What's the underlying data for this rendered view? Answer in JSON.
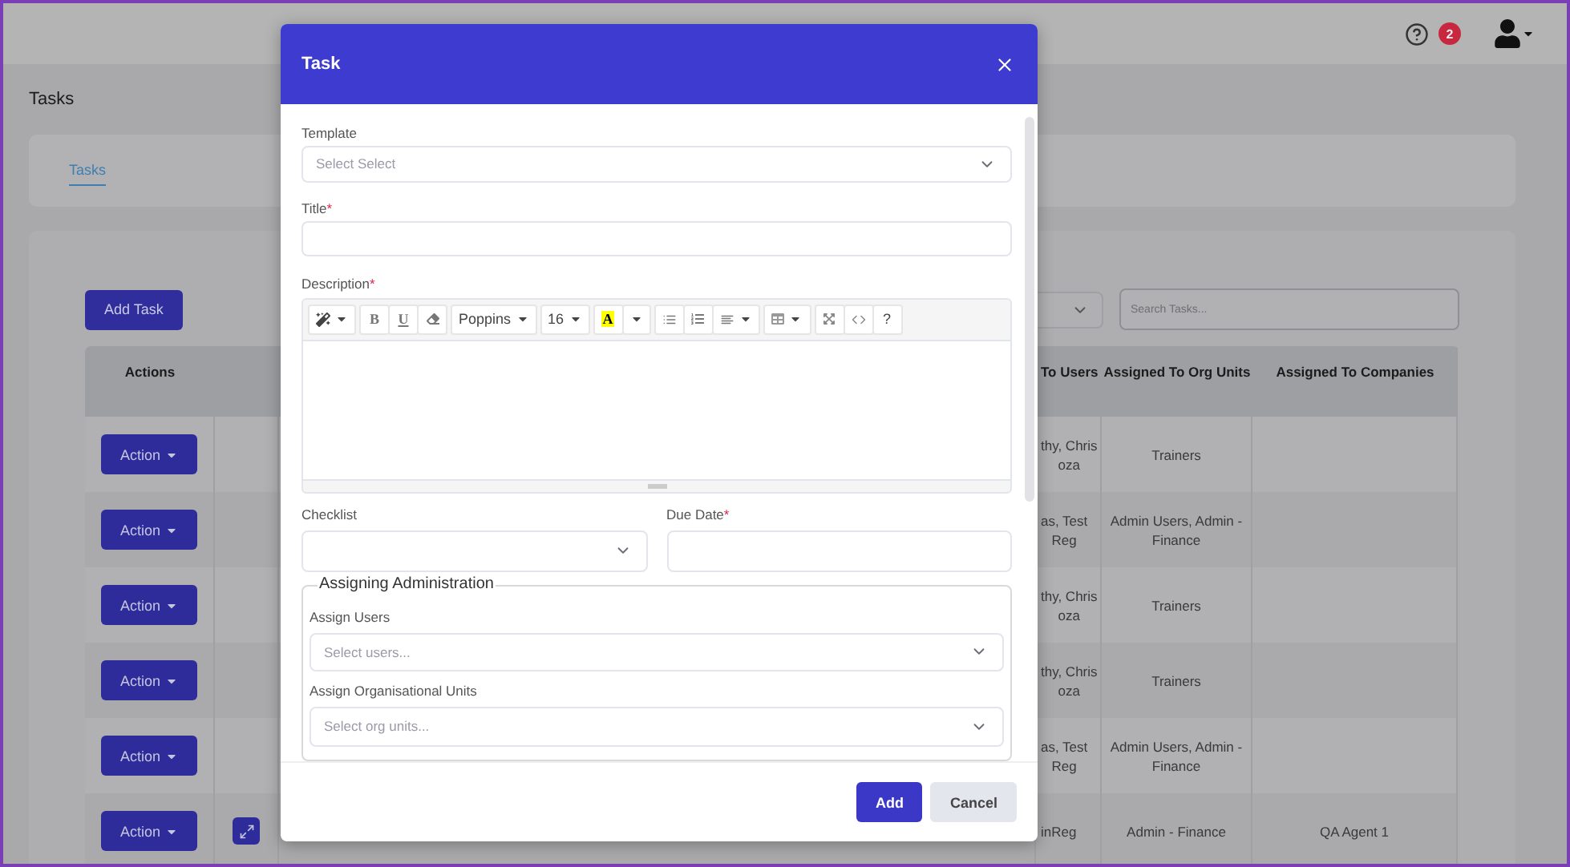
{
  "topbar": {
    "notifications": "2"
  },
  "page": {
    "title": "Tasks",
    "tabs": [
      {
        "label": "Tasks",
        "selected": true
      }
    ]
  },
  "toolbar": {
    "add_button": "Add Task",
    "search": {
      "placeholder": "Search Tasks..."
    }
  },
  "table": {
    "columns": [
      "Actions",
      "To Users",
      "Assigned To Org Units",
      "Assigned To Companies"
    ],
    "rows": [
      {
        "action": "Action",
        "expand": false,
        "users": "thy, Chris\noza",
        "org_units": "Trainers"
      },
      {
        "action": "Action",
        "expand": false,
        "users": "as, Test\nReg",
        "org_units": "Admin Users, Admin - Finance"
      },
      {
        "action": "Action",
        "expand": false,
        "users": "thy, Chris\noza",
        "org_units": "Trainers"
      },
      {
        "action": "Action",
        "expand": false,
        "users": "thy, Chris\noza",
        "org_units": "Trainers"
      },
      {
        "action": "Action",
        "expand": false,
        "users": "as, Test\nReg",
        "org_units": "Admin Users, Admin - Finance"
      },
      {
        "action": "Action",
        "expand": true,
        "users": "inReg",
        "org_units": "Admin - Finance",
        "companies": "QA Agent 1"
      }
    ]
  },
  "modal": {
    "title": "Task",
    "template": {
      "label": "Template",
      "placeholder": "Select Select"
    },
    "title_field": {
      "label": "Title",
      "required_mark": "*"
    },
    "description": {
      "label": "Description",
      "required_mark": "*",
      "toolbar": [
        [
          {
            "kind": "style"
          }
        ],
        [
          {
            "kind": "bold",
            "text": "B"
          },
          {
            "kind": "underline",
            "text": "U"
          },
          {
            "kind": "clear"
          }
        ],
        [
          {
            "kind": "font",
            "text": "Poppins"
          }
        ],
        [
          {
            "kind": "size",
            "text": "16"
          }
        ],
        [
          {
            "kind": "color",
            "text": "A"
          },
          {
            "kind": "color-menu"
          }
        ],
        [
          {
            "kind": "bullets"
          },
          {
            "kind": "numbers"
          },
          {
            "kind": "align"
          }
        ],
        [
          {
            "kind": "table"
          }
        ],
        [
          {
            "kind": "fullscreen"
          },
          {
            "kind": "code"
          },
          {
            "kind": "help",
            "text": "?"
          }
        ]
      ]
    },
    "checklist": {
      "label": "Checklist"
    },
    "due_date": {
      "label": "Due Date",
      "required_mark": "*"
    },
    "assigning": {
      "legend": "Assigning Administration",
      "users": {
        "label": "Assign Users",
        "placeholder": "Select users..."
      },
      "org_units": {
        "label": "Assign Organisational Units",
        "placeholder": "Select org units..."
      }
    },
    "buttons": [
      {
        "kind": "primary",
        "label": "Add"
      },
      {
        "kind": "secondary",
        "label": "Cancel"
      }
    ]
  }
}
